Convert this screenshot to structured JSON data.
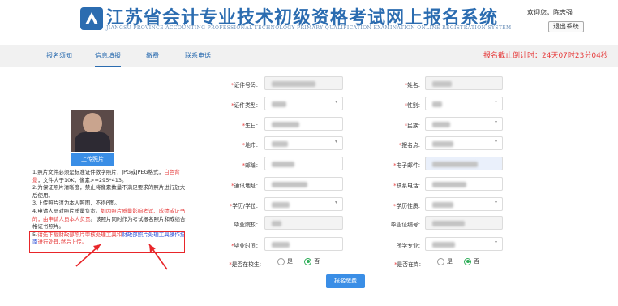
{
  "header": {
    "title": "江苏省会计专业技术初级资格考试网上报名系统",
    "subtitle": "JIANGSU PROVINCE ACCOUNTING PROFESSIONAL TECHNOLOGY PRIMARY QUALIFICATION EXAMINATION ONLINE REGISTRATION SYSTEM",
    "welcome": "欢迎您，陈志强",
    "logout": "退出系统"
  },
  "nav": {
    "tabs": [
      "报名须知",
      "信息填报",
      "缴费",
      "联系电话"
    ],
    "active": "信息填报",
    "countdown": "报名截止倒计时：24天07时23分04秒"
  },
  "photo": {
    "upload_label": "上传照片"
  },
  "notes": {
    "n1": "1.照片文件必须是标准证件数字照片，JPG或JPEG格式，",
    "n1_red": "白色背景",
    "n1_tail": "，文件大于10K，像素>=295*413。",
    "n2": "2.为保证照片清晰度，禁止将像素数量不满足要求的照片进行放大后使用。",
    "n3": "3.上传照片须为本人照图，不得P图。",
    "n4_a": "4.申请人员对照片质量负责。",
    "n4_red": "如因照片质量影响考试、成绩或证书的，由申请人员本人负责",
    "n4_tail": "。该照片同时作为考试报名照片和成绩合格证书照片。",
    "n5_a": "5.",
    "n5_red": "请先下载财政部照片审核处理工具和",
    "n5_blue": "财政部照片处理工具操作指南",
    "n5_red2": "进行处理,然后上传。"
  },
  "form": {
    "left": [
      {
        "label": "证件号码:",
        "required": true,
        "kind": "text"
      },
      {
        "label": "证件类型:",
        "required": true,
        "kind": "select"
      },
      {
        "label": "生日:",
        "required": true,
        "kind": "text"
      },
      {
        "label": "地市:",
        "required": true,
        "kind": "select"
      },
      {
        "label": "邮编:",
        "required": true,
        "kind": "text"
      },
      {
        "label": "通讯地址:",
        "required": true,
        "kind": "text"
      },
      {
        "label": "学历/学位:",
        "required": true,
        "kind": "select"
      },
      {
        "label": "毕业院校:",
        "required": false,
        "kind": "text"
      },
      {
        "label": "毕业时间:",
        "required": true,
        "kind": "text"
      }
    ],
    "right": [
      {
        "label": "姓名:",
        "required": true,
        "kind": "text"
      },
      {
        "label": "性别:",
        "required": true,
        "kind": "select"
      },
      {
        "label": "民族:",
        "required": true,
        "kind": "select"
      },
      {
        "label": "报名点:",
        "required": true,
        "kind": "select"
      },
      {
        "label": "电子邮件:",
        "required": true,
        "kind": "text"
      },
      {
        "label": "联系电话:",
        "required": true,
        "kind": "text"
      },
      {
        "label": "学历性质:",
        "required": true,
        "kind": "select"
      },
      {
        "label": "毕业证编号:",
        "required": false,
        "kind": "text"
      },
      {
        "label": "所学专业:",
        "required": false,
        "kind": "select"
      }
    ],
    "in_school_label": "是否在校生:",
    "in_job_label": "是否在岗:",
    "radio_yes": "是",
    "radio_no": "否",
    "in_school_value": "否",
    "in_job_value": "否",
    "submit": "报名缴费"
  },
  "colors": {
    "brand_blue": "#2b6cb0",
    "button_blue": "#3a8ee6",
    "warning_red": "#e63c3c",
    "radio_green": "#2fae58"
  }
}
